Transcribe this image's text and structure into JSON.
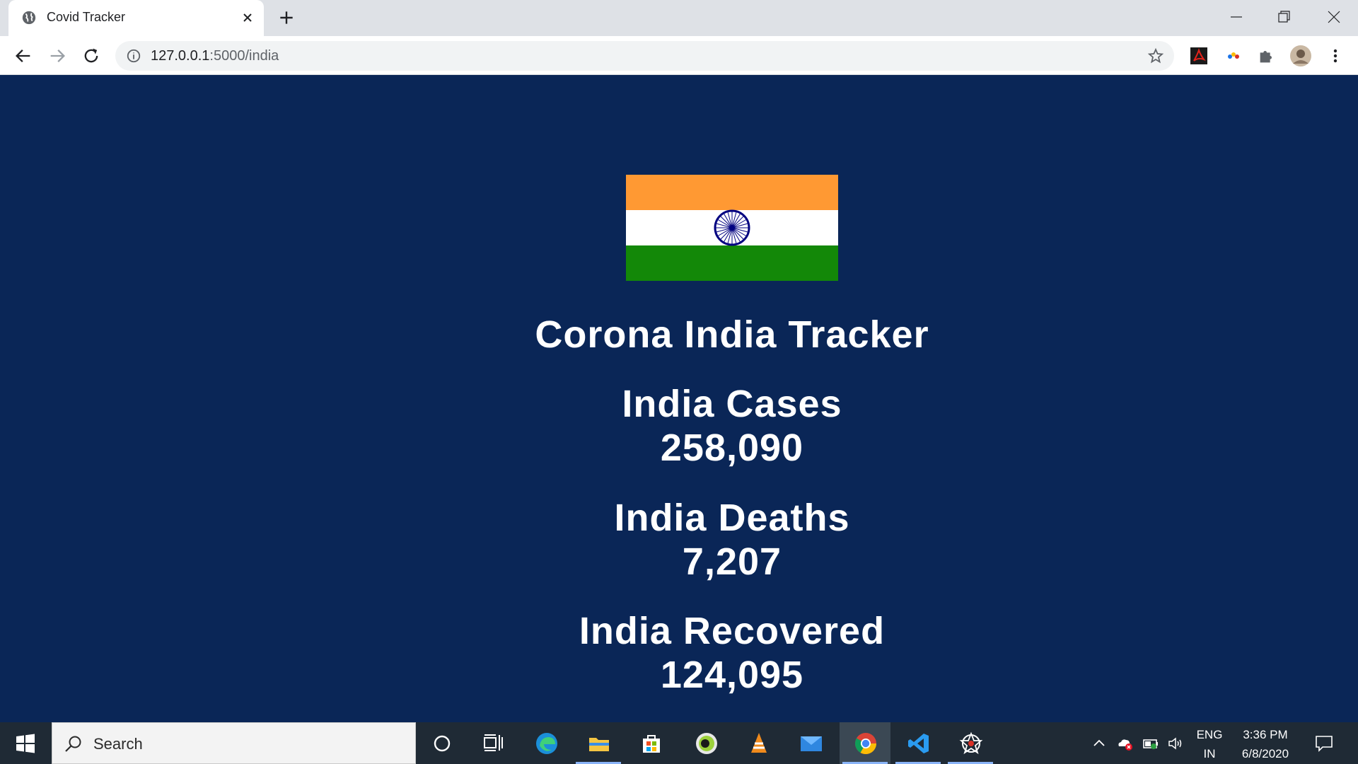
{
  "browser": {
    "tab_title": "Covid Tracker",
    "url_host": "127.0.0.1",
    "url_path": ":5000/india"
  },
  "page": {
    "title": "Corona India Tracker",
    "stats": [
      {
        "label": "India Cases",
        "value": "258,090"
      },
      {
        "label": "India Deaths",
        "value": "7,207"
      },
      {
        "label": "India Recovered",
        "value": "124,095"
      }
    ],
    "background_color": "#0a2657",
    "flag_colors": {
      "saffron": "#ff9933",
      "white": "#ffffff",
      "green": "#138808",
      "chakra": "#000080"
    }
  },
  "taskbar": {
    "search_placeholder": "Search",
    "pinned_apps": [
      "cortana",
      "task-view",
      "edge",
      "file-explorer",
      "microsoft-store",
      "app-green",
      "vlc",
      "mail",
      "chrome",
      "vscode",
      "network-app"
    ],
    "language_top": "ENG",
    "language_bottom": "IN",
    "time": "3:36 PM",
    "date": "6/8/2020"
  }
}
